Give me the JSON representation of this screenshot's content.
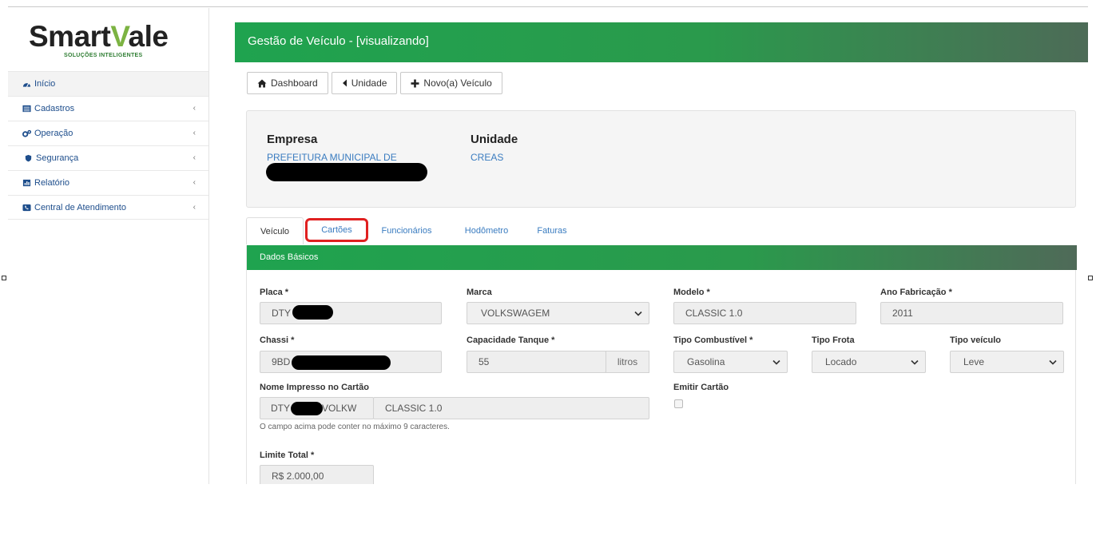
{
  "sidebar": {
    "logo": {
      "text_main_a": "Smart",
      "text_main_v": "V",
      "text_main_b": "ale",
      "tagline": "SOLUÇÕES INTELIGENTES"
    },
    "items": [
      {
        "label": "Início",
        "icon": "dashboard-icon",
        "active": true,
        "has_chevron": false
      },
      {
        "label": "Cadastros",
        "icon": "list-icon",
        "active": false,
        "has_chevron": true
      },
      {
        "label": "Operação",
        "icon": "cogs-icon",
        "active": false,
        "has_chevron": true
      },
      {
        "label": "Segurança",
        "icon": "shield-icon",
        "active": false,
        "has_chevron": true
      },
      {
        "label": "Relatório",
        "icon": "report-icon",
        "active": false,
        "has_chevron": true
      },
      {
        "label": "Central de Atendimento",
        "icon": "phone-icon",
        "active": false,
        "has_chevron": true
      }
    ],
    "chevron": "‹"
  },
  "header": {
    "title": "Gestão de Veículo - [visualizando]"
  },
  "toolbar": {
    "dashboard_label": "Dashboard",
    "unidade_label": "Unidade",
    "novo_label": "Novo(a) Veículo"
  },
  "info": {
    "empresa_label": "Empresa",
    "empresa_value": "PREFEITURA MUNICIPAL DE",
    "unidade_label": "Unidade",
    "unidade_value": "CREAS"
  },
  "tabs": [
    {
      "label": "Veículo",
      "active": true
    },
    {
      "label": "Cartões",
      "active": false,
      "highlighted": true
    },
    {
      "label": "Funcionários",
      "active": false
    },
    {
      "label": "Hodômetro",
      "active": false
    },
    {
      "label": "Faturas",
      "active": false
    }
  ],
  "section": {
    "title": "Dados Básicos",
    "placa": {
      "label": "Placa *",
      "value": "DTY"
    },
    "marca": {
      "label": "Marca",
      "value": "VOLKSWAGEM"
    },
    "modelo": {
      "label": "Modelo *",
      "value": "CLASSIC 1.0"
    },
    "ano": {
      "label": "Ano Fabricação *",
      "value": "2011"
    },
    "chassi": {
      "label": "Chassi *",
      "value": "9BD"
    },
    "capacidade": {
      "label": "Capacidade Tanque *",
      "value": "55",
      "unit": "litros"
    },
    "combustivel": {
      "label": "Tipo Combustível *",
      "value": "Gasolina"
    },
    "frota": {
      "label": "Tipo Frota",
      "value": "Locado"
    },
    "tipo_veiculo": {
      "label": "Tipo veículo",
      "value": "Leve"
    },
    "nome_impresso": {
      "label": "Nome Impresso no Cartão",
      "value_a": "DTY",
      "value_b": "VOLKW",
      "value_c": "CLASSIC 1.0",
      "help": "O campo acima pode conter no máximo 9 caracteres."
    },
    "emitir": {
      "label": "Emitir Cartão",
      "checked": false
    },
    "limite": {
      "label": "Limite Total *",
      "value": "R$ 2.000,00"
    }
  }
}
